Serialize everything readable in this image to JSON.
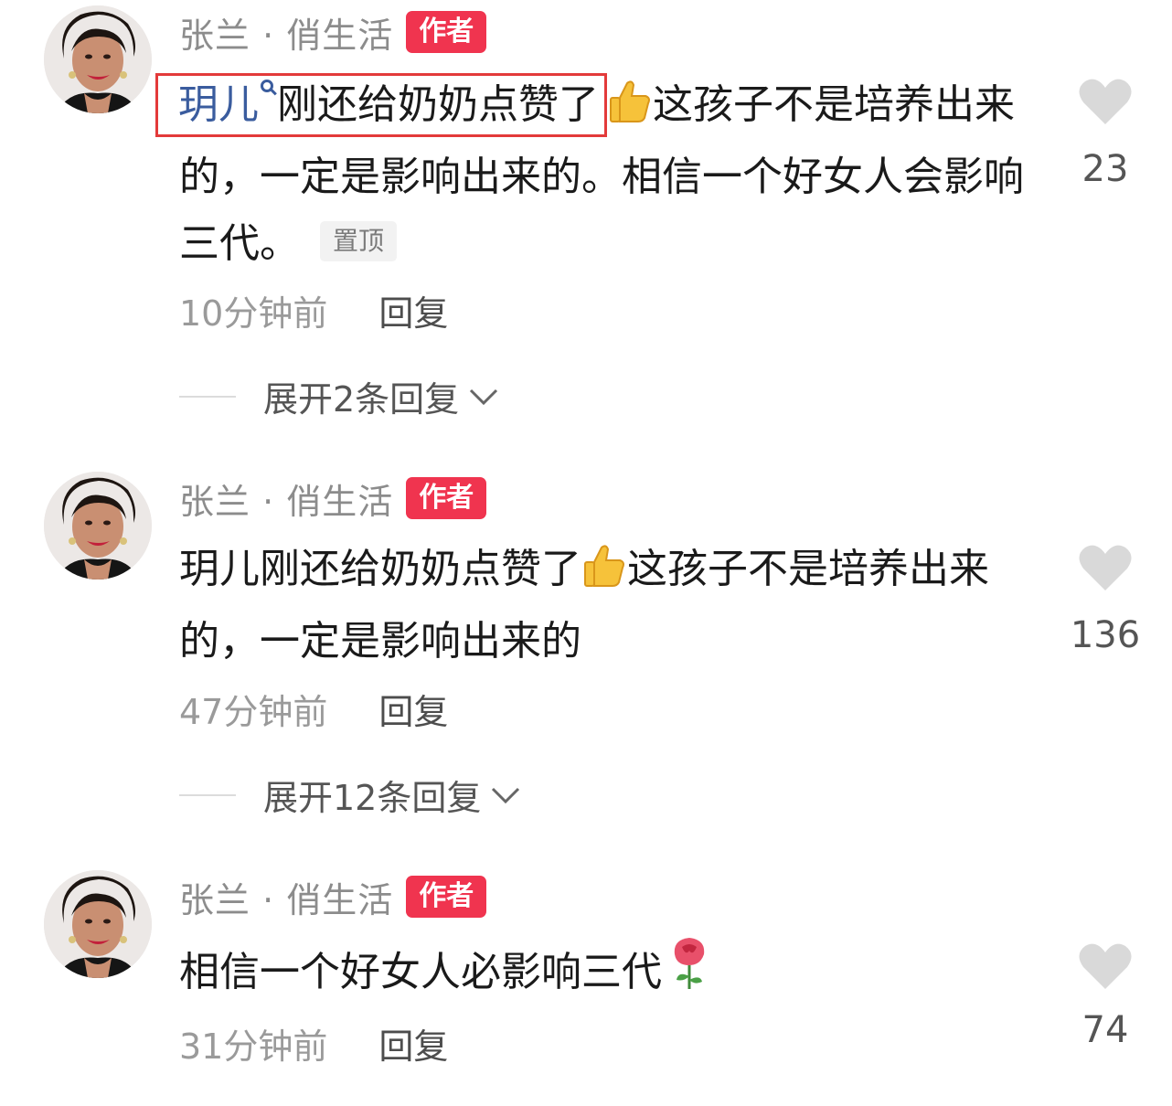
{
  "comments": [
    {
      "author": "张兰 · 俏生活",
      "badge": "作者",
      "mention": "玥儿",
      "text_part1": "刚还给奶奶点赞了",
      "text_part2": "这孩子不是培养出来的，一定是影响出来的。相信一个好女人会影响三代。",
      "pinned_tag": "置顶",
      "time": "10分钟前",
      "reply": "回复",
      "expand_replies": "展开2条回复",
      "likes": "23"
    },
    {
      "author": "张兰 · 俏生活",
      "badge": "作者",
      "text_part1": "玥儿刚还给奶奶点赞了",
      "text_part2": "这孩子不是培养出来的，一定是影响出来的",
      "time": "47分钟前",
      "reply": "回复",
      "expand_replies": "展开12条回复",
      "likes": "136"
    },
    {
      "author": "张兰 · 俏生活",
      "badge": "作者",
      "text_part1": "相信一个好女人必影响三代",
      "time": "31分钟前",
      "reply": "回复",
      "likes": "74"
    }
  ],
  "icons": {
    "like": "heart-icon",
    "thumbs_up": "thumbs-up-emoji",
    "rose": "rose-emoji",
    "expand": "chevron-down-icon",
    "mention": "search-icon"
  },
  "colors": {
    "badge": "#f0344f",
    "mention": "#3a5c9e",
    "highlight_box": "#e33a3a",
    "heart": "#d9d9d9"
  }
}
